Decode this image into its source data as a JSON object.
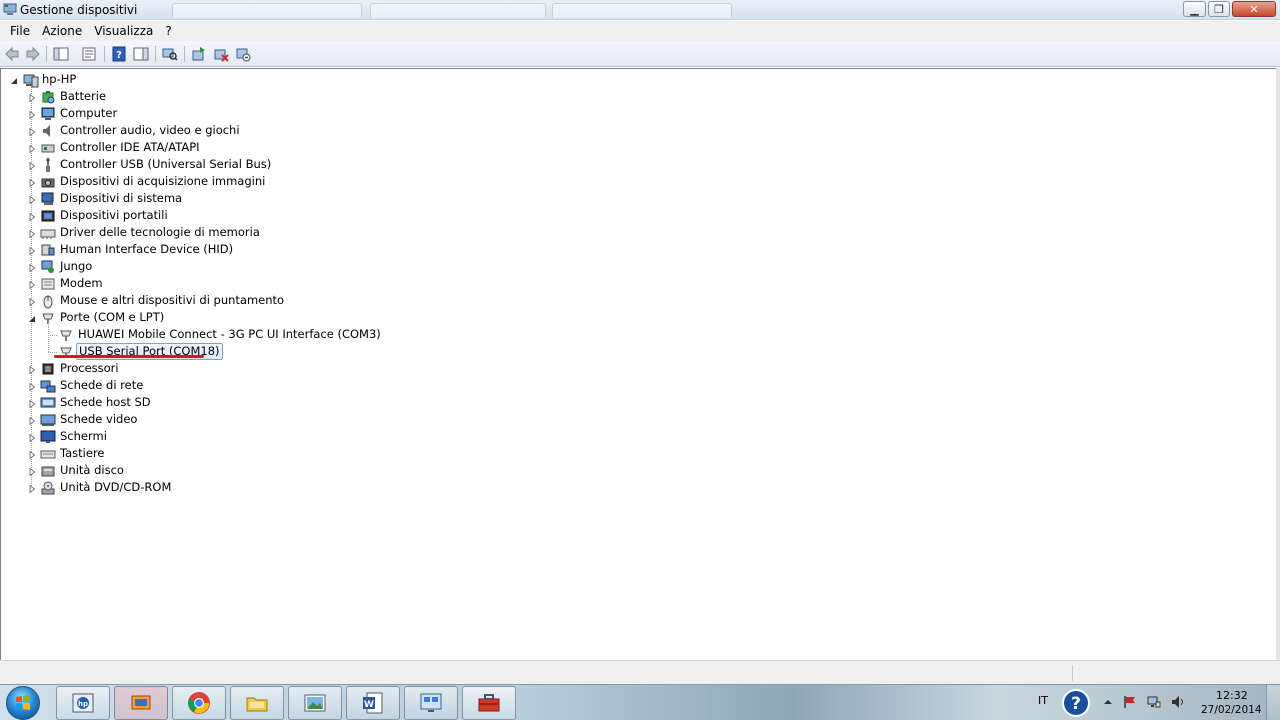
{
  "window": {
    "title": "Gestione dispositivi",
    "minimize_glyph": "▁",
    "maximize_glyph": "❐",
    "close_glyph": "✕"
  },
  "menu": {
    "items": [
      "File",
      "Azione",
      "Visualizza",
      "?"
    ]
  },
  "toolbar": {
    "icons": [
      "back-arrow-icon",
      "forward-arrow-icon",
      "show-hide-console-tree-icon",
      "properties-icon",
      "help-icon",
      "action-pane-icon",
      "scan-hardware-icon",
      "update-driver-icon",
      "uninstall-icon",
      "disable-device-icon"
    ]
  },
  "tree": {
    "root": "hp-HP",
    "categories": [
      {
        "label": "Batterie",
        "icon": "battery-icon"
      },
      {
        "label": "Computer",
        "icon": "computer-icon"
      },
      {
        "label": "Controller audio, video e giochi",
        "icon": "speaker-icon"
      },
      {
        "label": "Controller IDE ATA/ATAPI",
        "icon": "ide-controller-icon"
      },
      {
        "label": "Controller USB (Universal Serial Bus)",
        "icon": "usb-icon"
      },
      {
        "label": "Dispositivi di acquisizione immagini",
        "icon": "camera-icon"
      },
      {
        "label": "Dispositivi di sistema",
        "icon": "system-device-icon"
      },
      {
        "label": "Dispositivi portatili",
        "icon": "portable-device-icon"
      },
      {
        "label": "Driver delle tecnologie di memoria",
        "icon": "memory-icon"
      },
      {
        "label": "Human Interface Device (HID)",
        "icon": "hid-icon"
      },
      {
        "label": "Jungo",
        "icon": "jungo-icon"
      },
      {
        "label": "Modem",
        "icon": "modem-icon"
      },
      {
        "label": "Mouse e altri dispositivi di puntamento",
        "icon": "mouse-icon"
      },
      {
        "label": "Porte (COM e LPT)",
        "icon": "port-icon",
        "expanded": true,
        "children": [
          {
            "label": "HUAWEI Mobile Connect - 3G PC UI Interface (COM3)",
            "icon": "port-icon"
          },
          {
            "label": "USB Serial Port (COM18)",
            "icon": "port-icon",
            "selected": true
          }
        ]
      },
      {
        "label": "Processori",
        "icon": "processor-icon"
      },
      {
        "label": "Schede di rete",
        "icon": "network-adapter-icon"
      },
      {
        "label": "Schede host SD",
        "icon": "sd-host-icon"
      },
      {
        "label": "Schede video",
        "icon": "display-adapter-icon"
      },
      {
        "label": "Schermi",
        "icon": "monitor-icon"
      },
      {
        "label": "Tastiere",
        "icon": "keyboard-icon"
      },
      {
        "label": "Unità disco",
        "icon": "disk-drive-icon"
      },
      {
        "label": "Unità DVD/CD-ROM",
        "icon": "dvd-drive-icon"
      }
    ]
  },
  "taskbar": {
    "apps": [
      "hp-support-icon",
      "media-player-icon",
      "chrome-icon",
      "file-explorer-icon",
      "photo-viewer-icon",
      "word-icon",
      "remote-desktop-icon",
      "toolbox-icon"
    ],
    "language": "IT",
    "time": "12:32",
    "date": "27/02/2014"
  },
  "colors": {
    "selection_border": "#7da2ce",
    "annotation_red": "#d6172a"
  }
}
